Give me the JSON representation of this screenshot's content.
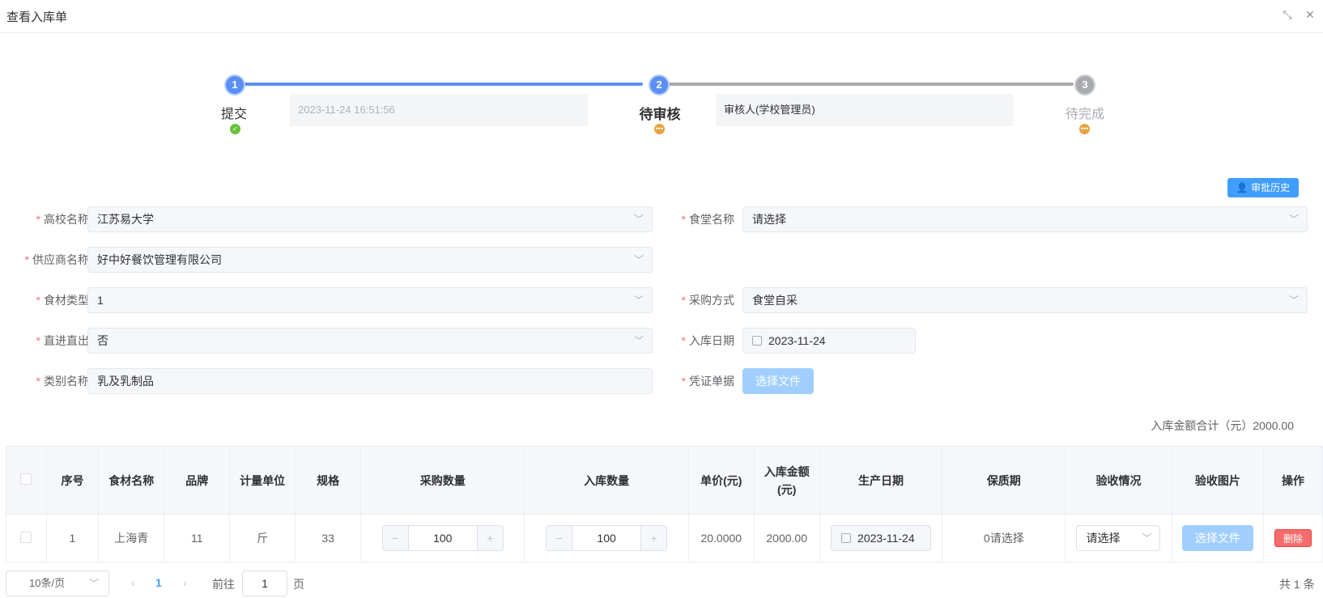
{
  "dialog": {
    "title": "查看入库单"
  },
  "steps": [
    {
      "num": "1",
      "title": "提交",
      "status_icon": "check",
      "info": "2023-11-24 16:51:56"
    },
    {
      "num": "2",
      "title": "待审核",
      "status_icon": "more",
      "info": "审核人(学校管理员)"
    },
    {
      "num": "3",
      "title": "待完成",
      "status_icon": "more"
    }
  ],
  "history_button": "审批历史",
  "form": {
    "school": {
      "label": "高校名称",
      "value": "江苏易大学"
    },
    "canteen": {
      "label": "食堂名称",
      "value": "请选择"
    },
    "supplier": {
      "label": "供应商名称",
      "value": "好中好餐饮管理有限公司"
    },
    "material_type": {
      "label": "食材类型",
      "value": "1"
    },
    "purchase_method": {
      "label": "采购方式",
      "value": "食堂自采"
    },
    "direct_in_out": {
      "label": "直进直出",
      "value": "否"
    },
    "stock_date": {
      "label": "入库日期",
      "value": "2023-11-24"
    },
    "category": {
      "label": "类别名称",
      "value": "乳及乳制品"
    },
    "voucher": {
      "label": "凭证单据",
      "button": "选择文件"
    }
  },
  "total": "入库金额合计（元）2000.00",
  "table": {
    "headers": [
      "序号",
      "食材名称",
      "品牌",
      "计量单位",
      "规格",
      "采购数量",
      "入库数量",
      "单价(元)",
      "入库金额(元)",
      "生产日期",
      "保质期",
      "验收情况",
      "验收图片",
      "操作"
    ],
    "rows": [
      {
        "index": "1",
        "name": "上海青",
        "brand": "11",
        "unit": "斤",
        "spec": "33",
        "purchase_qty": "100",
        "stock_qty": "100",
        "price": "20.0000",
        "amount": "2000.00",
        "prod_date": "2023-11-24",
        "shelf_life": "0请选择",
        "acceptance": "请选择",
        "image_button": "选择文件",
        "delete_button": "删除"
      }
    ]
  },
  "pagination": {
    "page_size": "10条/页",
    "current_page": "1",
    "goto_label": "前往",
    "goto_value": "1",
    "page_suffix": "页",
    "total": "共 1 条"
  },
  "colors": {
    "primary": "#409eff",
    "step_active": "#5a8ff5",
    "step_inactive": "#b2b4b8",
    "success": "#67c23a",
    "warning": "#e6a23c",
    "danger": "#f56c6c"
  }
}
